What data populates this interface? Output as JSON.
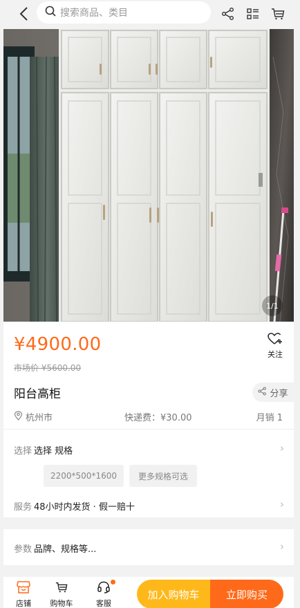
{
  "search": {
    "placeholder": "搜索商品、类目"
  },
  "gallery": {
    "pager": "1/1"
  },
  "product": {
    "price": "¥4900.00",
    "market_price": "市场价 ¥5600.00",
    "follow_label": "关注",
    "title": "阳台高柜",
    "share_label": "分享",
    "location": "杭州市",
    "shipping": "快递费：¥30.00",
    "monthly_sales": "月销 1"
  },
  "spec": {
    "label": "选择",
    "value": "选择 规格",
    "chips": [
      "2200*500*1600",
      "更多规格可选"
    ]
  },
  "service": {
    "label": "服务",
    "value": "48小时内发货 · 假一赔十"
  },
  "params": {
    "label": "参数",
    "value": "品牌、规格等..."
  },
  "bottom": {
    "shop": "店铺",
    "cart": "购物车",
    "service": "客服",
    "add_to_cart": "加入购物车",
    "buy_now": "立即购买"
  },
  "colors": {
    "accent": "#ff6a1a",
    "cart_button": "#ffb81a"
  },
  "icons": [
    "back-icon",
    "search-icon",
    "share-icon",
    "list-icon",
    "cart-icon",
    "heart-plus-icon",
    "location-icon",
    "chevron-right-icon",
    "shop-icon",
    "headset-icon"
  ]
}
